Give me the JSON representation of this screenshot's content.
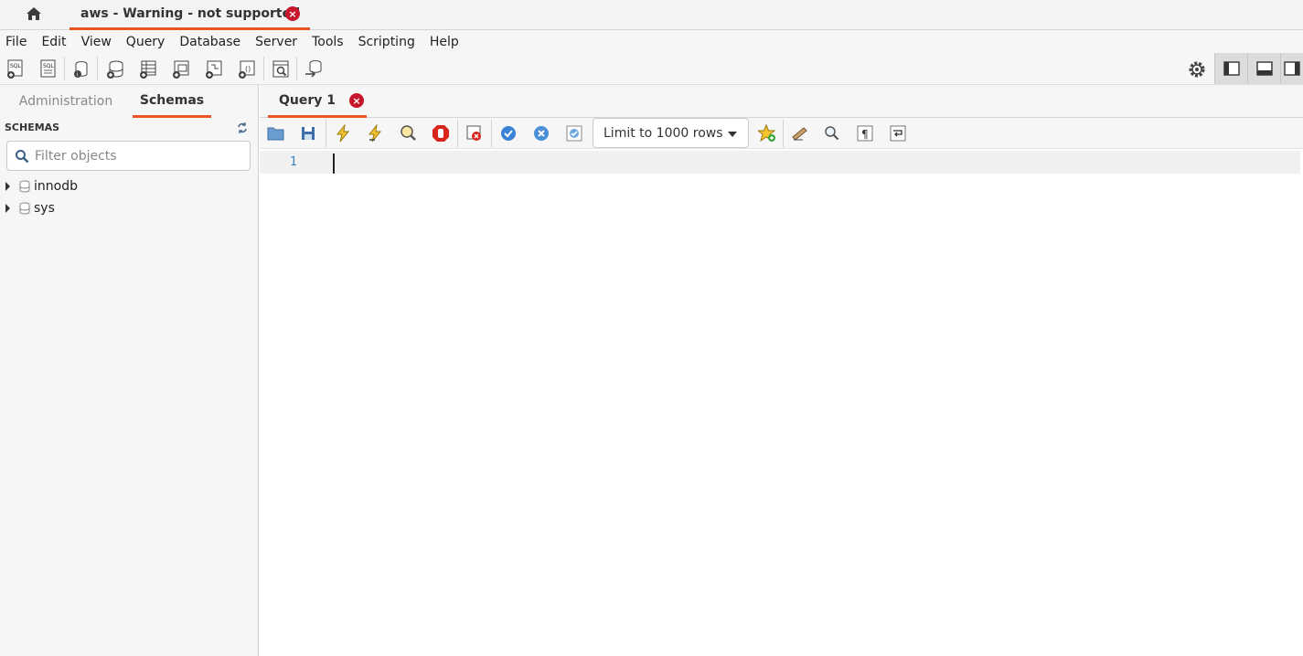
{
  "connection_tab": {
    "title": "aws - Warning - not supported",
    "close_glyph": "×"
  },
  "menubar": {
    "items": [
      "File",
      "Edit",
      "View",
      "Query",
      "Database",
      "Server",
      "Tools",
      "Scripting",
      "Help"
    ]
  },
  "main_toolbar": {
    "icons": [
      "new-sql-tab-icon",
      "open-sql-script-icon",
      "session-info-icon",
      "create-schema-icon",
      "create-table-icon",
      "create-view-icon",
      "create-procedure-icon",
      "create-function-icon",
      "search-table-data-icon",
      "reconnect-icon"
    ],
    "right_icons": [
      "settings-gear-icon",
      "toggle-sidebar-icon",
      "toggle-output-icon",
      "toggle-secondary-sidebar-icon"
    ]
  },
  "sidebar": {
    "tabs": [
      "Administration",
      "Schemas"
    ],
    "active_tab": "Schemas",
    "section_title": "SCHEMAS",
    "filter_placeholder": "Filter objects",
    "schemas": [
      "innodb",
      "sys"
    ]
  },
  "query_tab": {
    "label": "Query 1",
    "close_glyph": "×"
  },
  "query_toolbar": {
    "limit_label": "Limit to 1000 rows",
    "icons": [
      "open-file-icon",
      "save-script-icon",
      "execute-icon",
      "execute-current-icon",
      "explain-icon",
      "stop-icon",
      "toggle-error-icon",
      "commit-icon",
      "rollback-icon",
      "autocommit-icon",
      "add-snippet-icon",
      "beautify-icon",
      "find-icon",
      "invisible-chars-icon",
      "word-wrap-icon"
    ]
  },
  "editor": {
    "line_number": "1"
  },
  "colors": {
    "accent": "#e95420",
    "close_red": "#c7162b",
    "line_number": "#3a7fbf"
  }
}
